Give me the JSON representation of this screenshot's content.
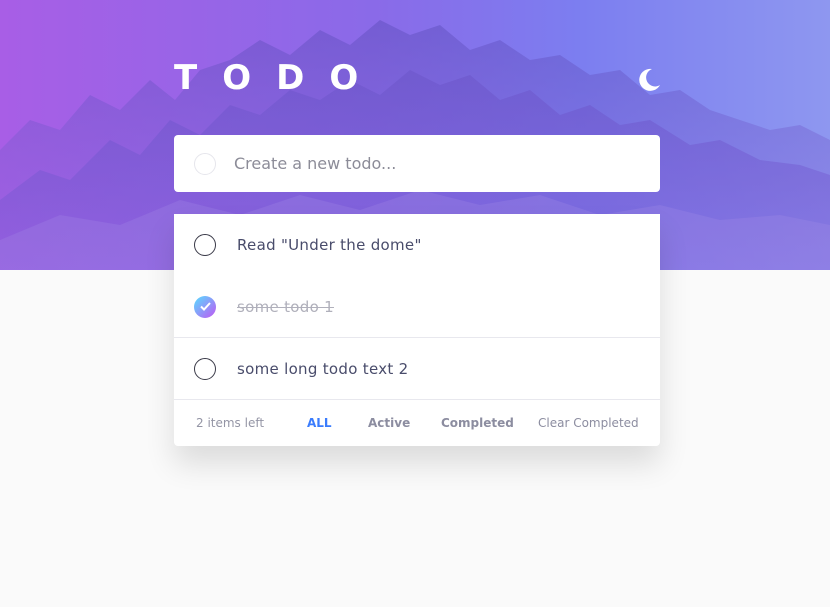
{
  "header": {
    "title": "TODO",
    "theme_toggle_icon": "moon-icon"
  },
  "new_todo": {
    "placeholder": "Create a new todo..."
  },
  "todos": [
    {
      "text": "Read \"Under the dome\"",
      "completed": false
    },
    {
      "text": "some todo 1",
      "completed": true
    },
    {
      "text": "some long todo text 2",
      "completed": false
    }
  ],
  "footer": {
    "items_left": "2 items left",
    "filters": {
      "all": "ALL",
      "active": "Active",
      "completed": "Completed"
    },
    "active_filter": "all",
    "clear_completed": "Clear Completed"
  },
  "colors": {
    "accent": "#3a7cfd",
    "gradient_start": "#57ddff",
    "gradient_end": "#c058f3",
    "hero_left": "#a85ee6",
    "hero_right": "#8e97f0",
    "background": "#fafafa"
  }
}
